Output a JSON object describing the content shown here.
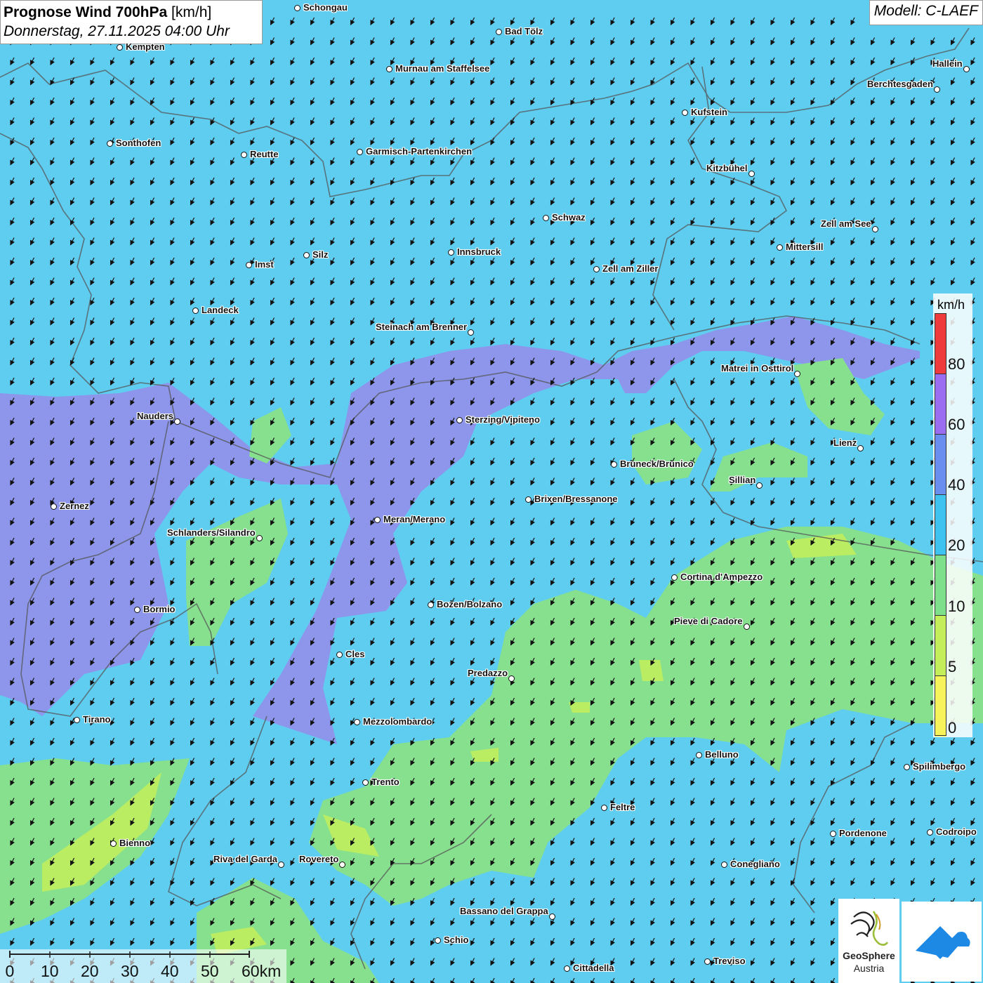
{
  "title": {
    "main": "Prognose Wind 700hPa",
    "unit": "[km/h]",
    "datetime": "Donnerstag, 27.11.2025 04:00 Uhr"
  },
  "model": "Modell: C-LAEF",
  "legend": {
    "unit": "km/h",
    "ticks": [
      "80",
      "60",
      "40",
      "20",
      "10",
      "5",
      "0"
    ],
    "colors": [
      "#ef3b3b",
      "#9b6df0",
      "#6a8ef0",
      "#3ec3f0",
      "#7ee08a",
      "#c4ee5a",
      "#f7f35a"
    ]
  },
  "scalebar": {
    "labels": [
      "0",
      "10",
      "20",
      "30",
      "40",
      "50",
      "60km"
    ]
  },
  "logos": {
    "geosphere_line1": "GeoSphere",
    "geosphere_line2": "Austria"
  },
  "wind": {
    "direction": "north-northeast (blowing toward south-southwest)"
  },
  "cities": [
    {
      "name": "Schongau"
    },
    {
      "name": "Bad Tölz"
    },
    {
      "name": "Kempten"
    },
    {
      "name": "Murnau am Staffelsee"
    },
    {
      "name": "Hallein"
    },
    {
      "name": "Berchtesgaden"
    },
    {
      "name": "Kufstein"
    },
    {
      "name": "Sonthofen"
    },
    {
      "name": "Reutte"
    },
    {
      "name": "Garmisch-Partenkirchen"
    },
    {
      "name": "Kitzbühel"
    },
    {
      "name": "Schwaz"
    },
    {
      "name": "Zell am See"
    },
    {
      "name": "Mittersill"
    },
    {
      "name": "Innsbruck"
    },
    {
      "name": "Silz"
    },
    {
      "name": "Imst"
    },
    {
      "name": "Zell am Ziller"
    },
    {
      "name": "Landeck"
    },
    {
      "name": "Steinach am Brenner"
    },
    {
      "name": "Matrei in Osttirol"
    },
    {
      "name": "Nauders"
    },
    {
      "name": "Sterzing/Vipiteno"
    },
    {
      "name": "Lienz"
    },
    {
      "name": "Bruneck/Brunico"
    },
    {
      "name": "Sillian"
    },
    {
      "name": "Zernez"
    },
    {
      "name": "Brixen/Bressanone"
    },
    {
      "name": "Meran/Merano"
    },
    {
      "name": "Schlanders/Silandro"
    },
    {
      "name": "Cortina d'Ampezzo"
    },
    {
      "name": "Bozen/Bolzano"
    },
    {
      "name": "Bormio"
    },
    {
      "name": "Pieve di Cadore"
    },
    {
      "name": "Cles"
    },
    {
      "name": "Predazzo"
    },
    {
      "name": "Tirano"
    },
    {
      "name": "Mezzolombardo"
    },
    {
      "name": "Belluno"
    },
    {
      "name": "Spilimbergo"
    },
    {
      "name": "Trento"
    },
    {
      "name": "Feltre"
    },
    {
      "name": "Pordenone"
    },
    {
      "name": "Codroipo"
    },
    {
      "name": "Bienno"
    },
    {
      "name": "Riva del Garda"
    },
    {
      "name": "Rovereto"
    },
    {
      "name": "Conegliano"
    },
    {
      "name": "Bassano del Grappa"
    },
    {
      "name": "Schio"
    },
    {
      "name": "Treviso"
    },
    {
      "name": "Cittadella"
    }
  ]
}
